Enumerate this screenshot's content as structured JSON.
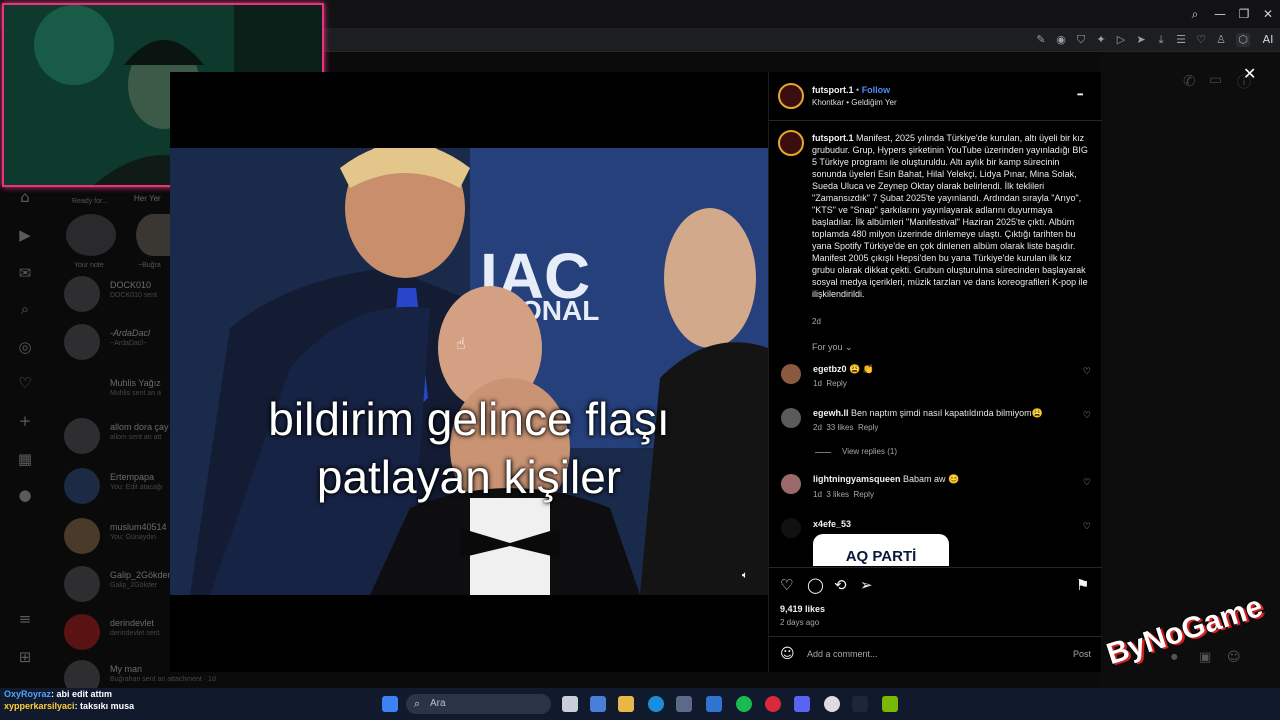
{
  "post": {
    "username": "futsport.1",
    "separator": "•",
    "follow_label": "Follow",
    "subtitle": "Khontkar • Geldiğim Yer",
    "more_label": "•••",
    "caption_user": "futsport.1",
    "caption_text": "Manifest, 2025 yılında Türkiye'de kurulan, altı üyeli bir kız grubudur. Grup, Hypers şirketinin YouTube üzerinden yayınladığı BIG 5 Türkiye programı ile oluşturuldu. Altı aylık bir kamp sürecinin sonunda üyeleri Esin Bahat, Hilal Yelekçi, Lidya Pınar, Mina Solak, Sueda Uluca ve Zeynep Oktay olarak belirlendi. İlk teklileri \"Zamansızdık\" 7 Şubat 2025'te yayınlandı. Ardından sırayla \"Arıyo\", \"KTS\" ve \"Snap\" şarkılarını yayınlayarak adlarını duyurmaya başladılar. İlk albümleri \"Manifestival\" Haziran 2025'te çıktı. Albüm toplamda 480 milyon üzerinde dinlemeye ulaştı. Çıktığı tarihten bu yana Spotify Türkiye'de en çok dinlenen albüm olarak liste başıdır.",
    "caption_text_2": "Manifest 2005 çıkışlı Hepsi'den bu yana Türkiye'de kurulan ilk kız grubu olarak dikkat çekti. Grubun oluşturulma sürecinden başlayarak sosyal medya içerikleri, müzik tarzları ve dans koreografileri K-pop ile ilişkilendirildi.",
    "caption_age": "2d",
    "for_you_label": "For you",
    "likes": "9,419 likes",
    "time_ago": "2 days ago",
    "add_comment_placeholder": "Add a comment...",
    "post_button": "Post"
  },
  "comments": [
    {
      "user": "egetbz0",
      "text": "😩 👏",
      "age": "1d",
      "likes": "",
      "reply": "Reply"
    },
    {
      "user": "egewh.ll",
      "text": "Ben naptım şimdi nasıl kapatıldında bilmiyom😩",
      "age": "2d",
      "likes": "33 likes",
      "reply": "Reply",
      "view_replies": "View replies (1)"
    },
    {
      "user": "lightningyamsqueen",
      "text": "Babam aw 😊",
      "age": "1d",
      "likes": "3 likes",
      "reply": "Reply"
    },
    {
      "user": "x4efe_53",
      "text": "",
      "age": "",
      "likes": "",
      "reply": "",
      "image_text": "AQ PARTİ"
    }
  ],
  "video": {
    "caption_line1": "bildirim gelince flaşı",
    "caption_line2": "patlayan kişiler",
    "sign_text": "IAC",
    "sign_text_2": "ONAL",
    "volume_icon": "volume-icon"
  },
  "sidebar": {
    "story_labels": [
      "Ready for...",
      "Her Yer"
    ],
    "story_names": [
      "Your note",
      "~Buğra"
    ],
    "dms": [
      {
        "name": "DOCK010",
        "sub": "DOCK010 sent"
      },
      {
        "name": "-ArdaDacl",
        "sub": "~ArdaDacl~"
      },
      {
        "name": "Muhlis Yağız",
        "sub": "Muhlis sent an a"
      },
      {
        "name": "allom dora çay",
        "sub": "allom sent an att"
      },
      {
        "name": "Ertempapa",
        "sub": "You: Edit atacağı"
      },
      {
        "name": "muslum40514",
        "sub": "You: Günaydın"
      },
      {
        "name": "Galip_2Gökder",
        "sub": "Galip_2Gökder"
      },
      {
        "name": "derindevlet",
        "sub": "derindevlet sent"
      },
      {
        "name": "My man",
        "sub": "Buğrahan sent an attachment · 1d"
      }
    ]
  },
  "toolbar": {
    "ai_label": "AI"
  },
  "watermark": "ByNoGame",
  "chat": [
    {
      "user": "OxyRoyraz",
      "msg": ": abi edit attım"
    },
    {
      "user": "xypperkarsilyaci",
      "msg": ": taksıkı musa"
    }
  ],
  "taskbar": {
    "search_placeholder": "Ara"
  },
  "colors": {
    "accent_follow": "#4c8df6",
    "webcam_border": "#e8337f",
    "story_ring": "#e4a72c"
  }
}
